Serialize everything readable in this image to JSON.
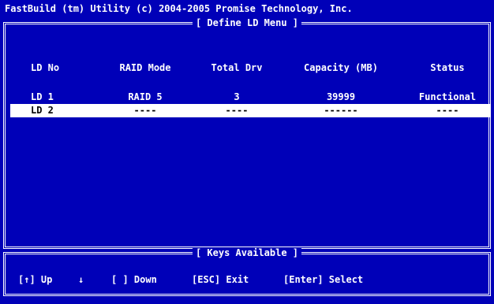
{
  "app_title": "FastBuild (tm) Utility (c) 2004-2005 Promise Technology, Inc.",
  "main_menu": {
    "title": "[ Define LD Menu ]",
    "columns": [
      "LD No",
      "RAID Mode",
      "Total Drv",
      "Capacity (MB)",
      "Status"
    ],
    "rows": [
      [
        "LD 1",
        "RAID 5",
        "3",
        "39999",
        "Functional"
      ],
      [
        "LD 2",
        "----",
        "----",
        "------",
        "----"
      ]
    ],
    "selected_row": 1
  },
  "keys_panel": {
    "title": "[ Keys Available ]",
    "keys": [
      "[↑] Up",
      "↓",
      "[ ] Down",
      "[ESC] Exit",
      "[Enter] Select"
    ]
  },
  "colors": {
    "background": "#0000b8",
    "foreground": "#ffffff",
    "highlight_bg": "#ffffff",
    "highlight_fg": "#000000"
  }
}
